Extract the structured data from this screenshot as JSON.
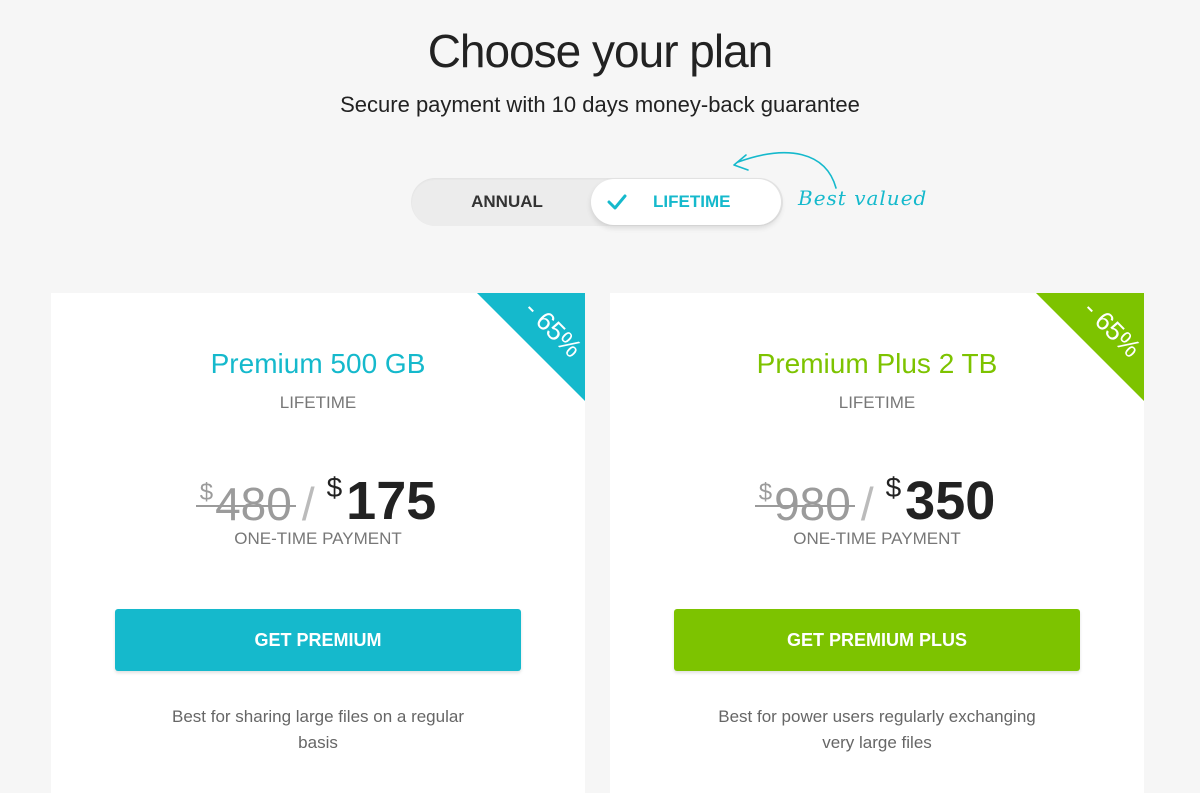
{
  "header": {
    "title": "Choose your plan",
    "subtitle": "Secure payment with 10 days money-back guarantee"
  },
  "toggle": {
    "options": [
      "ANNUAL",
      "LIFETIME"
    ],
    "selected": "LIFETIME",
    "annotation": "Best valued"
  },
  "colors": {
    "accent_teal": "#15b9cc",
    "accent_green": "#7dc300",
    "background": "#f6f6f6"
  },
  "plans": [
    {
      "name": "Premium 500 GB",
      "period": "LIFETIME",
      "discount": "- 65%",
      "currency": "$",
      "old_price": "480",
      "separator": "/",
      "new_price": "175",
      "payment_type": "ONE-TIME PAYMENT",
      "button_label": "GET PREMIUM",
      "description": "Best for sharing large files on a regular basis",
      "color": "#15b9cc"
    },
    {
      "name": "Premium Plus 2 TB",
      "period": "LIFETIME",
      "discount": "- 65%",
      "currency": "$",
      "old_price": "980",
      "separator": "/",
      "new_price": "350",
      "payment_type": "ONE-TIME PAYMENT",
      "button_label": "GET PREMIUM PLUS",
      "description": "Best for power users regularly exchanging very large files",
      "color": "#7dc300"
    }
  ]
}
